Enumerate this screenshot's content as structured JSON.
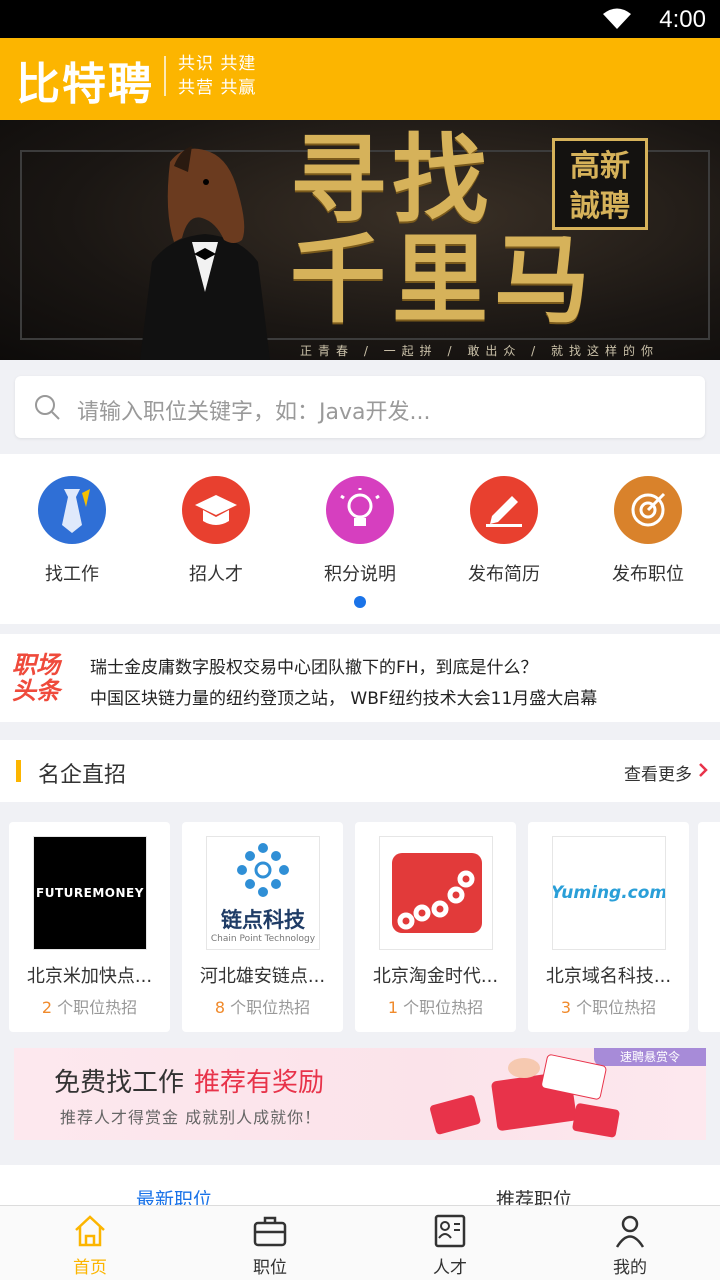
{
  "status_bar": {
    "time": "4:00"
  },
  "header": {
    "logo": "比特聘",
    "slogan_line1": "共识 共建",
    "slogan_line2": "共营 共赢"
  },
  "banner": {
    "headline_line1": "寻找",
    "headline_line2": "千里马",
    "stamp_line1": "高新",
    "stamp_line2": "誠聘",
    "tagline": "正青春 / 一起拼 / 敢出众 / 就找这样的你"
  },
  "search": {
    "placeholder": "请输入职位关键字，如：Java开发..."
  },
  "quick_actions": [
    {
      "label": "找工作",
      "icon": "tie-icon",
      "color": "#2f6fd6"
    },
    {
      "label": "招人才",
      "icon": "graduation-cap-icon",
      "color": "#e8402f"
    },
    {
      "label": "积分说明",
      "icon": "lightbulb-icon",
      "color": "#d63fbf"
    },
    {
      "label": "发布简历",
      "icon": "edit-icon",
      "color": "#e8402f"
    },
    {
      "label": "发布职位",
      "icon": "target-icon",
      "color": "#d9822b"
    }
  ],
  "news": {
    "badge_line1": "职场",
    "badge_line2": "头条",
    "items": [
      "瑞士金皮庸数字股权交易中心团队撤下的FH，到底是什么？",
      "中国区块链力量的纽约登顶之站， WBF纽约技术大会11月盛大启幕"
    ]
  },
  "companies_section": {
    "title": "名企直招",
    "more": "查看更多"
  },
  "companies": [
    {
      "name": "北京米加快点...",
      "jobs": "2",
      "jobs_suffix": " 个职位热招",
      "logo_text": "FUTUREMONEY"
    },
    {
      "name": "河北雄安链点...",
      "jobs": "8",
      "jobs_suffix": " 个职位热招",
      "logo_text": "链点科技",
      "logo_sub": "Chain Point Technology"
    },
    {
      "name": "北京淘金时代...",
      "jobs": "1",
      "jobs_suffix": " 个职位热招",
      "logo_text": ""
    },
    {
      "name": "北京域名科技...",
      "jobs": "3",
      "jobs_suffix": " 个职位热招",
      "logo_text": "Yuming.com"
    }
  ],
  "promo": {
    "title": "免费找工作",
    "title_red": "推荐有奖励",
    "subtitle": "推荐人才得赏金  成就别人成就你！",
    "tag": "速聘悬赏令"
  },
  "job_tabs": {
    "latest": "最新职位",
    "recommended": "推荐职位"
  },
  "bottom_nav": [
    {
      "label": "首页",
      "icon": "home-icon",
      "active": true
    },
    {
      "label": "职位",
      "icon": "briefcase-icon",
      "active": false
    },
    {
      "label": "人才",
      "icon": "id-card-icon",
      "active": false
    },
    {
      "label": "我的",
      "icon": "user-icon",
      "active": false
    }
  ],
  "colors": {
    "accent": "#fcb500",
    "link": "#1a73e8",
    "news_badge": "#ef4a3b"
  }
}
